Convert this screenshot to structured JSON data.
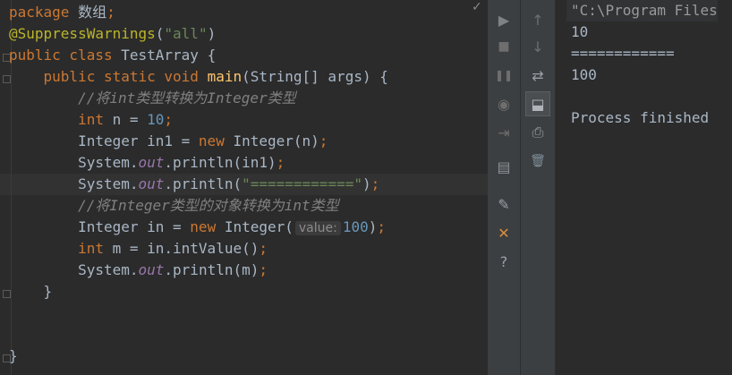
{
  "editor": {
    "lines": [
      [
        {
          "c": "kw",
          "t": "package "
        },
        {
          "c": "plain",
          "t": "数组"
        },
        {
          "c": "kw",
          "t": ";"
        }
      ],
      [
        {
          "c": "ann",
          "t": "@SuppressWarnings"
        },
        {
          "c": "plain",
          "t": "("
        },
        {
          "c": "str",
          "t": "\"all\""
        },
        {
          "c": "plain",
          "t": ")"
        }
      ],
      [
        {
          "c": "kw",
          "t": "public class "
        },
        {
          "c": "plain",
          "t": "TestArray {"
        }
      ],
      [
        {
          "c": "plain",
          "t": "    "
        },
        {
          "c": "kw",
          "t": "public static void "
        },
        {
          "c": "fn",
          "t": "main"
        },
        {
          "c": "plain",
          "t": "(String[] args) {"
        }
      ],
      [
        {
          "c": "cmt",
          "t": "        //将int类型转换为Integer类型"
        }
      ],
      [
        {
          "c": "plain",
          "t": "        "
        },
        {
          "c": "kw",
          "t": "int "
        },
        {
          "c": "plain",
          "t": "n = "
        },
        {
          "c": "num",
          "t": "10"
        },
        {
          "c": "kw",
          "t": ";"
        }
      ],
      [
        {
          "c": "plain",
          "t": "        Integer in1 = "
        },
        {
          "c": "kw",
          "t": "new "
        },
        {
          "c": "plain",
          "t": "Integer(n)"
        },
        {
          "c": "kw",
          "t": ";"
        }
      ],
      [
        {
          "c": "plain",
          "t": "        System."
        },
        {
          "c": "it",
          "t": "out"
        },
        {
          "c": "plain",
          "t": ".println(in1)"
        },
        {
          "c": "kw",
          "t": ";"
        }
      ],
      [
        {
          "c": "plain",
          "t": "        System."
        },
        {
          "c": "it",
          "t": "out"
        },
        {
          "c": "plain",
          "t": ".println("
        },
        {
          "c": "str",
          "t": "\"============\""
        },
        {
          "c": "plain",
          "t": ")"
        },
        {
          "c": "kw",
          "t": ";"
        }
      ],
      [
        {
          "c": "cmt",
          "t": "        //将Integer类型的对象转换为int类型"
        }
      ],
      [
        {
          "c": "plain",
          "t": "        Integer in = "
        },
        {
          "c": "kw",
          "t": "new "
        },
        {
          "c": "plain",
          "t": "Integer("
        },
        {
          "c": "hint",
          "t": "value:"
        },
        {
          "c": "num",
          "t": "100"
        },
        {
          "c": "plain",
          "t": ")"
        },
        {
          "c": "kw",
          "t": ";"
        }
      ],
      [
        {
          "c": "plain",
          "t": "        "
        },
        {
          "c": "kw",
          "t": "int "
        },
        {
          "c": "plain",
          "t": "m = in.intValue()"
        },
        {
          "c": "kw",
          "t": ";"
        }
      ],
      [
        {
          "c": "plain",
          "t": "        System."
        },
        {
          "c": "it",
          "t": "out"
        },
        {
          "c": "plain",
          "t": ".println(m)"
        },
        {
          "c": "kw",
          "t": ";"
        }
      ],
      [
        {
          "c": "plain",
          "t": "    }"
        }
      ],
      [],
      [],
      [
        {
          "c": "plain",
          "t": "}"
        }
      ]
    ],
    "checkmark": "✓"
  },
  "toolbar": {
    "run_icon": "▶",
    "stop_icon": "■",
    "pause_icon": "❚❚",
    "camera_icon": "◉",
    "exit_icon": "⇥",
    "layout_icon": "▤",
    "pin_icon": "✎",
    "close_icon": "✕",
    "help_icon": "?",
    "up_icon": "↑",
    "down_icon": "↓",
    "wrap_icon": "⇄",
    "scroll_end_icon": "⬓",
    "print_icon": "⎙",
    "trash_icon": "🗑"
  },
  "console": {
    "lines": [
      "\"C:\\Program Files",
      "10",
      "============",
      "100",
      "",
      "Process finished"
    ]
  }
}
